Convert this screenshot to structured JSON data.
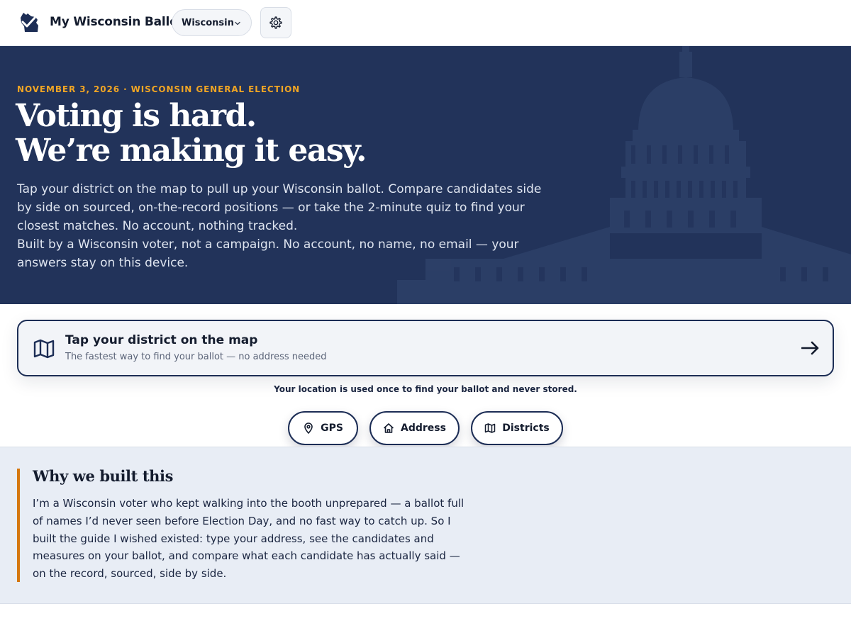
{
  "header": {
    "brand": "My Wisconsin Ballot",
    "state_select": {
      "value": "Wisconsin"
    },
    "settings_icon": "gear-icon"
  },
  "hero": {
    "eyebrow": "NOVEMBER 3, 2026 · WISCONSIN GENERAL ELECTION",
    "headline_line1": "Voting is hard.",
    "headline_line2": "We’re making it easy.",
    "paragraph1": "Tap your district on the map to pull up your Wisconsin ballot. Compare candidates side by side on sourced, on-the-record positions — or take the 2-minute quiz to find your closest matches. No account, nothing tracked.",
    "paragraph2": "Built by a Wisconsin voter, not a campaign. No account, no name, no email — your answers stay on this device."
  },
  "map_cta": {
    "title": "Tap your district on the map",
    "subtitle": "The fastest way to find your ballot — no address needed",
    "icon": "map-icon",
    "arrow_icon": "arrow-right-icon"
  },
  "privacy_note": "Your location is used once to find your ballot and never stored.",
  "lookup_options": [
    {
      "label": "GPS",
      "icon": "location-pin-icon"
    },
    {
      "label": "Address",
      "icon": "home-icon"
    },
    {
      "label": "Districts",
      "icon": "map-icon"
    }
  ],
  "why": {
    "heading": "Why we built this",
    "body": "I’m a Wisconsin voter who kept walking into the booth unprepared — a ballot full of names I’d never seen before Election Day, and no fast way to catch up. So I built the guide I wished existed: type your address, see the candidates and measures on your ballot, and compare what each candidate has actually said — on the record, sourced, side by side."
  },
  "colors": {
    "navy": "#22335a",
    "accent_gold": "#f0a524",
    "accent_orange": "#d5770f",
    "section_bg": "#e8edf5"
  }
}
